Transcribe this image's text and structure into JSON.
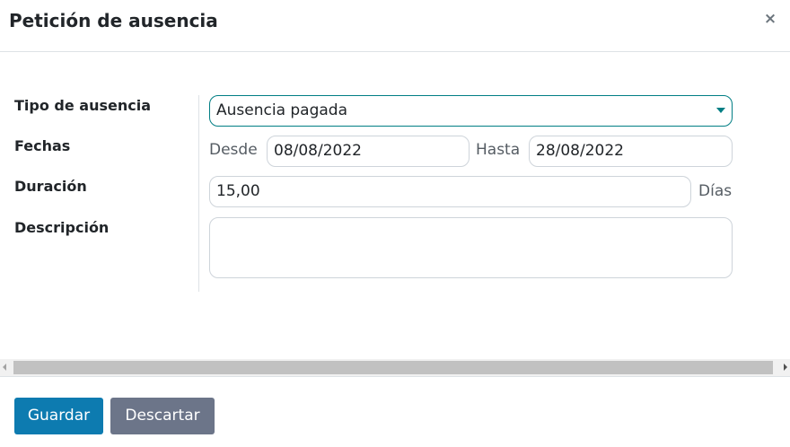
{
  "dialog": {
    "title": "Petición de ausencia",
    "close_label": "×"
  },
  "form": {
    "leave_type": {
      "label": "Tipo de ausencia",
      "value": "Ausencia pagada"
    },
    "dates": {
      "label": "Fechas",
      "from_label": "Desde",
      "from_value": "08/08/2022",
      "to_label": "Hasta",
      "to_value": "28/08/2022"
    },
    "duration": {
      "label": "Duración",
      "value": "15,00",
      "unit": "Días"
    },
    "description": {
      "label": "Descripción",
      "value": ""
    }
  },
  "footer": {
    "save_label": "Guardar",
    "discard_label": "Descartar"
  },
  "colors": {
    "primary": "#0d7bb0",
    "secondary": "#6c7589",
    "focus_border": "#017e84"
  }
}
